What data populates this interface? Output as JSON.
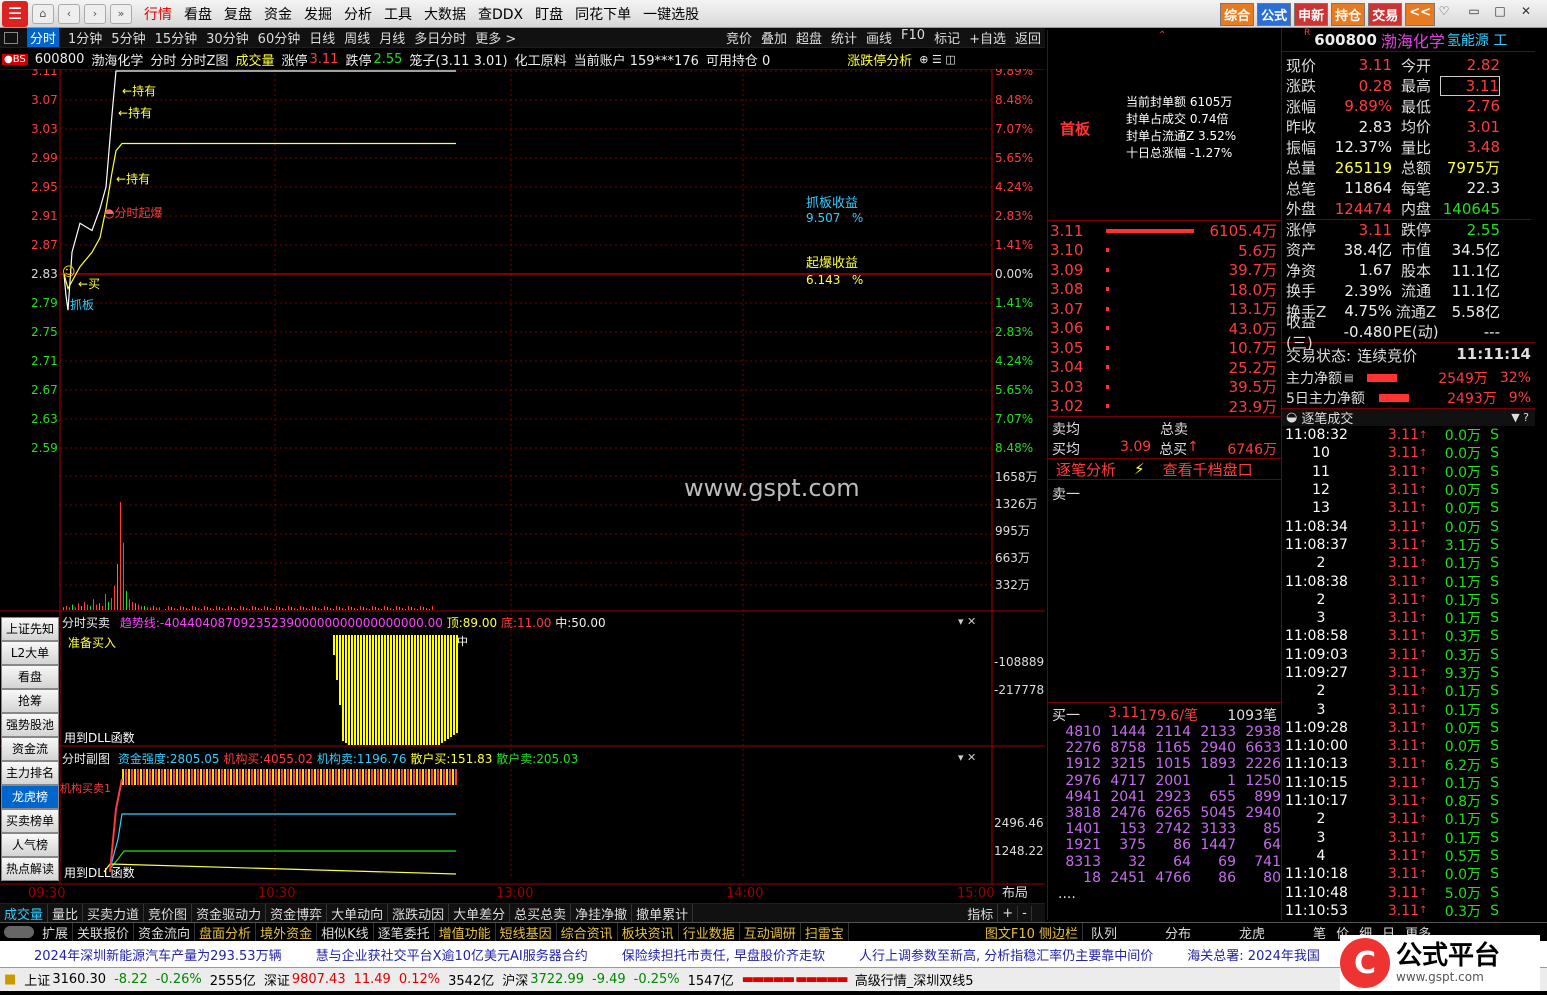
{
  "menubar": {
    "items": [
      "行情",
      "看盘",
      "复盘",
      "资金",
      "发掘",
      "分析",
      "工具",
      "大数据",
      "查DDX",
      "盯盘",
      "同花下单",
      "一键选股"
    ],
    "active": 0,
    "right_tabs": [
      "综合",
      "公式",
      "申新",
      "持仓",
      "交易",
      "<<"
    ]
  },
  "periods": {
    "items": [
      "分时",
      "1分钟",
      "5分钟",
      "15分钟",
      "30分钟",
      "60分钟",
      "日线",
      "周线",
      "月线",
      "多日分时",
      "更多 >"
    ],
    "tools": [
      "竞价",
      "叠加",
      "超盘",
      "统计",
      "画线",
      "F10",
      "标记",
      "+自选",
      "返回"
    ]
  },
  "info": {
    "code": "600800",
    "name": "渤海化学",
    "mode": "分时 分时Z图",
    "vol": "成交量",
    "zt_label": "涨停",
    "zt": "3.11",
    "dt_label": "跌停",
    "dt": "2.55",
    "cage": "笼子(3.11 3.01)",
    "industry": "化工原料",
    "account": "当前账户 159***176",
    "hold": "可用持仓 0",
    "analysis": "涨跌停分析"
  },
  "price_axis": {
    "left": [
      "3.11",
      "3.07",
      "3.03",
      "2.99",
      "2.95",
      "2.91",
      "2.87",
      "2.83",
      "2.79",
      "2.75",
      "2.71",
      "2.67",
      "2.63",
      "2.59"
    ],
    "right": [
      "9.89%",
      "8.48%",
      "7.07%",
      "5.65%",
      "4.24%",
      "2.83%",
      "1.41%",
      "0.00%",
      "1.41%",
      "2.83%",
      "4.24%",
      "5.65%",
      "7.07%",
      "8.48%"
    ]
  },
  "vol_axis": [
    "1658万",
    "1326万",
    "995万",
    "663万",
    "332万"
  ],
  "annotations": {
    "hold1": "持有",
    "hold2": "持有",
    "hold3": "持有",
    "fengdan": "分时起爆",
    "buy": "买",
    "grab": "抓板",
    "grab_label": "抓板收益",
    "grab_val": "9.507",
    "pct": "%",
    "boom_label": "起爆收益",
    "boom_val": "6.143",
    "pct2": "%",
    "watermark": "www.gspt.com"
  },
  "chart_data": [
    {
      "type": "line",
      "title": "",
      "x": [
        "09:30",
        "10:30",
        "13:00",
        "14:00",
        "15:00"
      ],
      "ylim": [
        2.57,
        3.11
      ],
      "series": [
        {
          "name": "",
          "values": [
            2.83,
            2.8,
            2.78,
            2.86,
            2.9,
            2.89,
            2.92,
            2.95,
            3.05,
            3.11,
            3.11,
            3.11
          ]
        },
        {
          "name": "",
          "values": [
            2.83,
            2.82,
            2.81,
            2.82,
            2.84,
            2.86,
            2.88,
            2.92,
            2.97,
            3.0,
            3.01,
            3.01
          ]
        }
      ]
    },
    {
      "type": "bar",
      "title": "",
      "values": [
        2,
        3,
        2,
        4,
        2,
        5,
        3,
        6,
        4,
        3,
        8,
        4,
        5,
        3,
        12,
        6,
        9,
        18,
        34,
        80,
        50,
        14,
        8,
        6,
        5,
        4,
        3,
        3,
        2,
        2,
        3,
        2,
        2
      ]
    }
  ],
  "sub1": {
    "title": "分时买卖",
    "trend_label": "趋势线:",
    "trend_val": "-4044040870923523900000000000000000.00",
    "top_label": "顶:",
    "top": "89.00",
    "bot_label": "底:",
    "bot": "11.00",
    "mid_label": "中:",
    "mid": "50.00",
    "prep": "准备买入",
    "dll": "用到DLL函数",
    "axis": [
      "-108889",
      "-217778"
    ]
  },
  "sub2": {
    "title": "分时副图",
    "str_label": "资金强度:",
    "str": "2805.05",
    "inst_buy_label": "机构买:",
    "inst_buy": "4055.02",
    "inst_sell_label": "机构卖:",
    "inst_sell": "1196.76",
    "ret_buy_label": "散户买:",
    "ret_buy": "151.83",
    "ret_sell_label": "散户卖:",
    "ret_sell": "205.03",
    "inst_tag": "机构买卖1",
    "dll": "用到DLL函数",
    "axis": [
      "2496.46",
      "1248.22"
    ]
  },
  "time_axis": [
    "09:30",
    "10:30",
    "13:00",
    "14:00",
    "15:00",
    "布局"
  ],
  "sidebar": [
    "上证先知",
    "L2大单",
    "看盘",
    "抢筹",
    "强势股池",
    "资金流",
    "主力排名",
    "龙虎榜",
    "买卖榜单",
    "人气榜",
    "热点解读"
  ],
  "bottom_tabs": [
    "成交量",
    "量比",
    "买卖力道",
    "竞价图",
    "资金驱动力",
    "资金博弈",
    "大单动向",
    "涨跌动因",
    "大单差分",
    "总买总卖",
    "净挂净撤",
    "撤单累计",
    "指标",
    "+",
    "-"
  ],
  "bottom2": [
    "扩展",
    "关联报价",
    "资金流向",
    "盘面分析",
    "境外资金",
    "相似K线",
    "逐笔委托",
    "增值功能",
    "短线基因",
    "综合资讯",
    "板块资讯",
    "行业数据",
    "互动调研",
    "扫雷宝",
    "图文F10 侧边栏"
  ],
  "bottom2_right": [
    "队列",
    "分布",
    "龙虎",
    "笔",
    "价",
    "细",
    "日",
    "更多"
  ],
  "news": [
    "2024年深圳新能源汽车产量为293.53万辆",
    "慧与企业获社交平台X逾10亿美元AI服务器合约",
    "保险续担托市责任, 早盘股价齐走软",
    "人行上调参数至新高, 分析指稳汇率仍主要靠中间价",
    "海关总署: 2024年我国"
  ],
  "status": {
    "sh_label": "上证",
    "sh": "3160.30",
    "sh_chg": "-8.22",
    "sh_pct": "-0.26%",
    "sh_amt": "2555亿",
    "sz_label": "深证",
    "sz": "9807.43",
    "sz_chg": "11.49",
    "sz_pct": "0.12%",
    "sz_amt": "3542亿",
    "hs_label": "沪深",
    "hs": "3722.99",
    "hs_chg": "-9.49",
    "hs_pct": "-0.25%",
    "hs_amt": "1547亿",
    "feed": "高级行情_深圳双线5"
  },
  "seal": {
    "tag": "首板",
    "lines": [
      "当前封单额 6105万",
      "封单占成交 0.74倍",
      "封单占流通Z 3.52%",
      "十日总涨幅 -1.27%"
    ]
  },
  "order_book": [
    {
      "p": "3.11",
      "v": "6105.4万"
    },
    {
      "p": "3.10",
      "v": "5.6万"
    },
    {
      "p": "3.09",
      "v": "39.7万"
    },
    {
      "p": "3.08",
      "v": "18.0万"
    },
    {
      "p": "3.07",
      "v": "13.1万"
    },
    {
      "p": "3.06",
      "v": "43.0万"
    },
    {
      "p": "3.05",
      "v": "10.7万"
    },
    {
      "p": "3.04",
      "v": "25.2万"
    },
    {
      "p": "3.03",
      "v": "39.5万"
    },
    {
      "p": "3.02",
      "v": "23.9万"
    }
  ],
  "book_bars": [
    1.0,
    0.03,
    0.03,
    0.03,
    0.03,
    0.03,
    0.03,
    0.03,
    0.03,
    0.03
  ],
  "avg": {
    "sell_avg": "卖均",
    "sell_total": "总卖",
    "buy_avg": "买均",
    "buy_price": "3.09",
    "buy_total": "总买",
    "buy_total_val": "6746万",
    "tick_analysis": "逐笔分析",
    "view_more": "查看千档盘口",
    "sell1": "卖一",
    "buy1": "买一",
    "buy1_p": "3.11",
    "buy1_v": "179.6/笔",
    "buy1_n": "1093笔",
    "dots": "...."
  },
  "queue": [
    [
      "4810",
      "1444",
      "2114",
      "2133",
      "2938"
    ],
    [
      "2276",
      "8758",
      "1165",
      "2940",
      "6633"
    ],
    [
      "1912",
      "3215",
      "1015",
      "1893",
      "2226"
    ],
    [
      "2976",
      "4717",
      "2001",
      "1",
      "1250"
    ],
    [
      "4941",
      "2041",
      "2923",
      "655",
      "899"
    ],
    [
      "3818",
      "2476",
      "6265",
      "5045",
      "2940"
    ],
    [
      "1401",
      "153",
      "2742",
      "3133",
      "85"
    ],
    [
      "1921",
      "375",
      "86",
      "1447",
      "64"
    ],
    [
      "8313",
      "32",
      "64",
      "69",
      "741"
    ],
    [
      "18",
      "2451",
      "4766",
      "86",
      "80"
    ]
  ],
  "stock": {
    "code": "600800",
    "name": "渤海化学",
    "tag": "氢能源 工",
    "r": "R"
  },
  "quote": [
    [
      "现价",
      "3.11",
      "今开",
      "2.82"
    ],
    [
      "涨跌",
      "0.28",
      "最高",
      "3.11"
    ],
    [
      "涨幅",
      "9.89%",
      "最低",
      "2.76"
    ],
    [
      "昨收",
      "2.83",
      "均价",
      "3.01"
    ],
    [
      "振幅",
      "12.37%",
      "量比",
      "3.48"
    ],
    [
      "总量",
      "265119",
      "总额",
      "7975万"
    ],
    [
      "总笔",
      "11864",
      "每笔",
      "22.3"
    ],
    [
      "外盘",
      "124474",
      "内盘",
      "140645"
    ],
    [
      "涨停",
      "3.11",
      "跌停",
      "2.55"
    ],
    [
      "资产",
      "38.4亿",
      "市值",
      "34.5亿"
    ],
    [
      "净资",
      "1.67",
      "股本",
      "11.1亿"
    ],
    [
      "换手",
      "2.39%",
      "流通",
      "11.1亿"
    ],
    [
      "换手Z",
      "4.75%",
      "流通Z",
      "5.58亿"
    ],
    [
      "收益(三)",
      "-0.480",
      "PE(动)",
      "---"
    ]
  ],
  "trade": {
    "state_label": "交易状态:",
    "state": "连续竞价",
    "time": "11:11:14",
    "main_label": "主力净额",
    "main": "2549万",
    "main_pct": "32%",
    "main5_label": "5日主力净额",
    "main5": "2493万",
    "main5_pct": "9%",
    "ticks_title": "逐笔成交"
  },
  "ticks": [
    [
      "11:08:32",
      "3.11",
      "0.0万"
    ],
    [
      "10",
      "3.11",
      "0.0万"
    ],
    [
      "11",
      "3.11",
      "0.0万"
    ],
    [
      "12",
      "3.11",
      "0.0万"
    ],
    [
      "13",
      "3.11",
      "0.0万"
    ],
    [
      "11:08:34",
      "3.11",
      "0.0万"
    ],
    [
      "11:08:37",
      "3.11",
      "3.1万"
    ],
    [
      "2",
      "3.11",
      "0.1万"
    ],
    [
      "11:08:38",
      "3.11",
      "0.1万"
    ],
    [
      "2",
      "3.11",
      "0.1万"
    ],
    [
      "3",
      "3.11",
      "0.1万"
    ],
    [
      "11:08:58",
      "3.11",
      "0.3万"
    ],
    [
      "11:09:03",
      "3.11",
      "0.3万"
    ],
    [
      "11:09:27",
      "3.11",
      "9.3万"
    ],
    [
      "2",
      "3.11",
      "0.1万"
    ],
    [
      "3",
      "3.11",
      "0.1万"
    ],
    [
      "11:09:28",
      "3.11",
      "0.0万"
    ],
    [
      "11:10:00",
      "3.11",
      "0.0万"
    ],
    [
      "11:10:13",
      "3.11",
      "6.2万"
    ],
    [
      "11:10:15",
      "3.11",
      "0.1万"
    ],
    [
      "11:10:17",
      "3.11",
      "0.8万"
    ],
    [
      "2",
      "3.11",
      "0.1万"
    ],
    [
      "3",
      "3.11",
      "0.1万"
    ],
    [
      "4",
      "3.11",
      "0.5万"
    ],
    [
      "11:10:18",
      "3.11",
      "0.0万"
    ],
    [
      "11:10:48",
      "3.11",
      "5.0万"
    ],
    [
      "11:10:53",
      "3.11",
      "0.3万"
    ]
  ],
  "tick_side": "S",
  "brand": {
    "name": "公式平台",
    "url": "www.gspt.com"
  },
  "colors": {
    "up": "#ff3b3b",
    "down": "#20e020",
    "price": "#ffffff",
    "avg": "#ffff40",
    "grid": "#700000"
  }
}
